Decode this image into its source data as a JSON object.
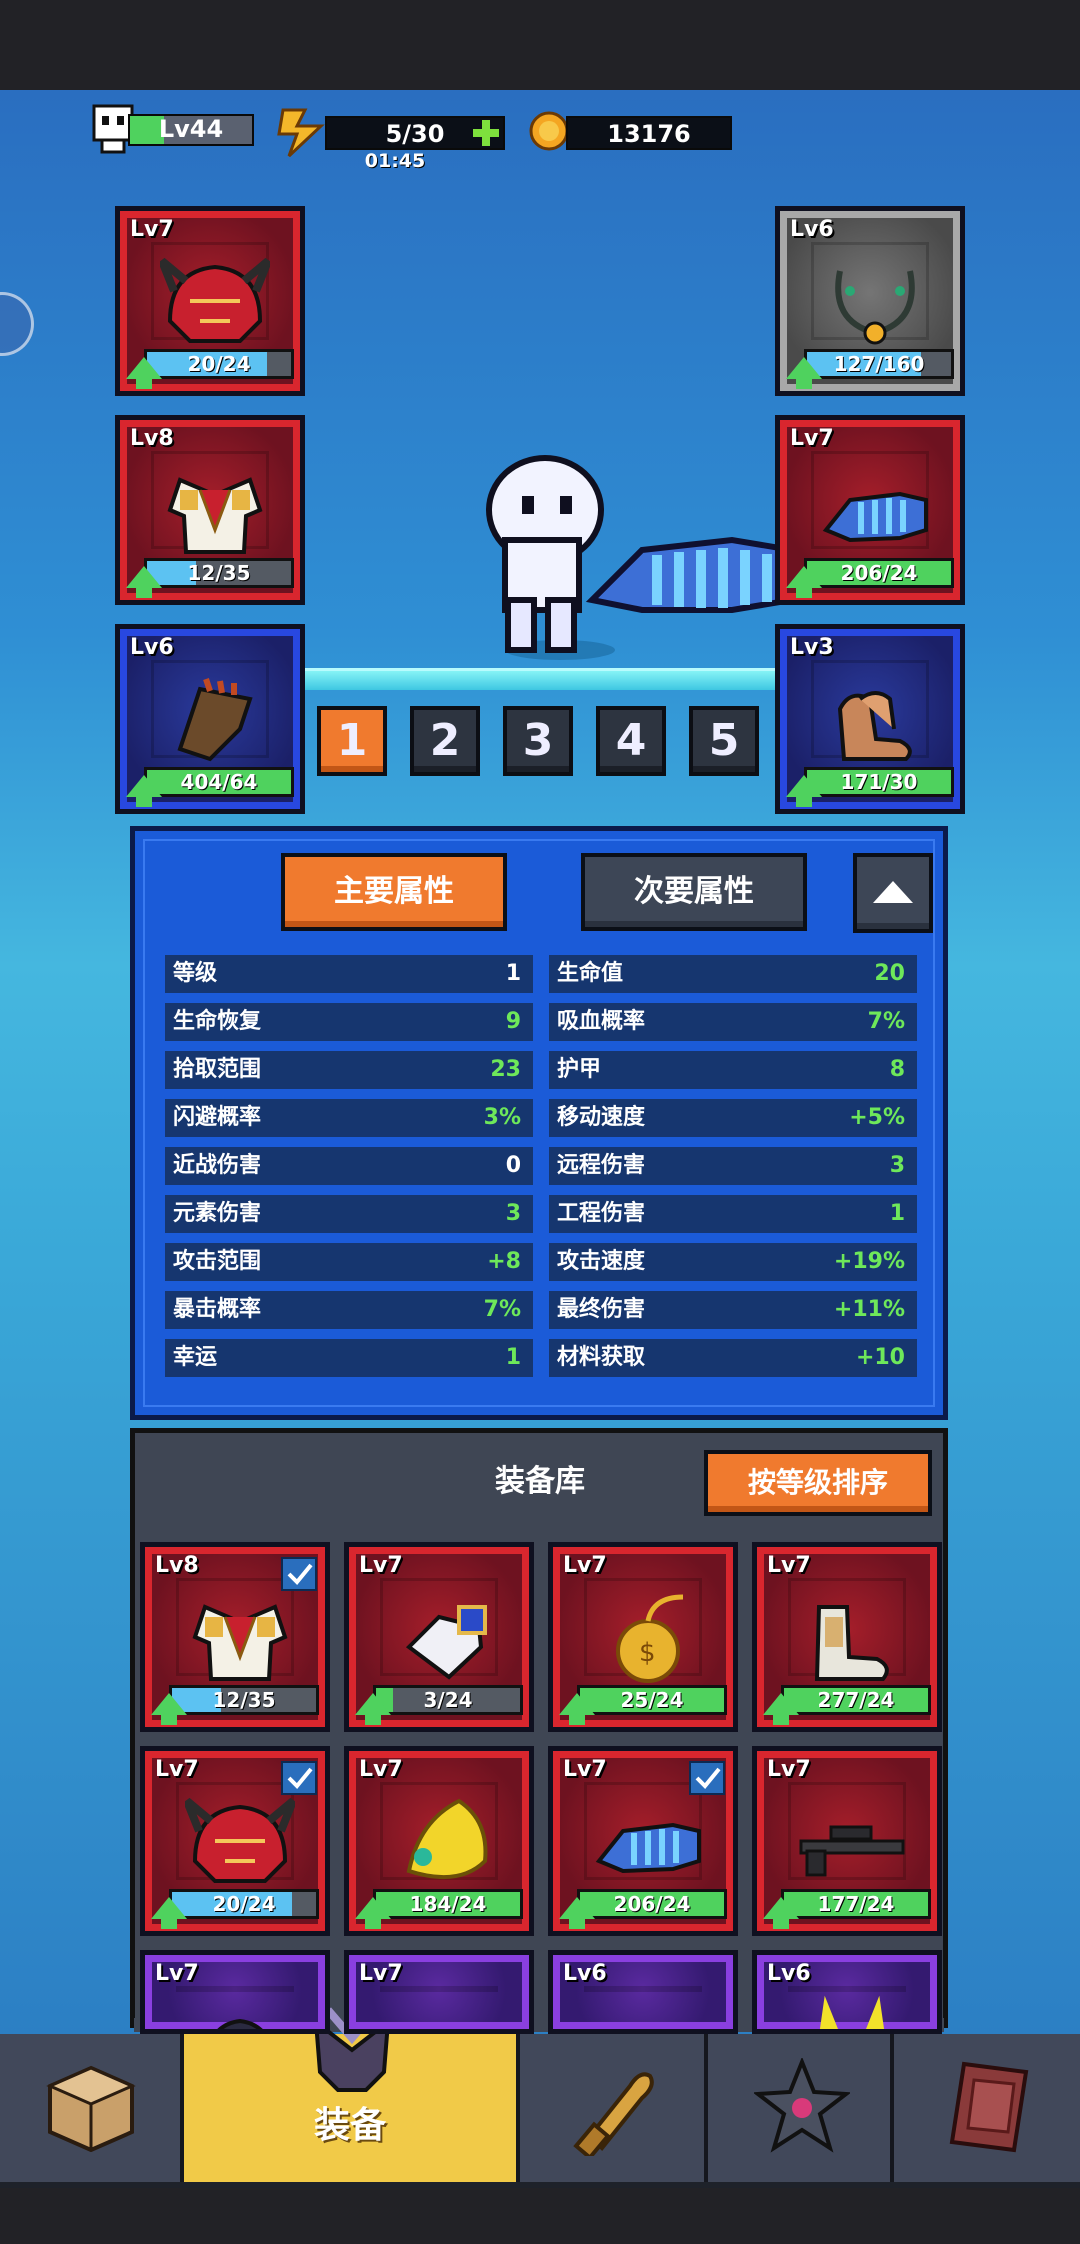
{
  "hud": {
    "player_level": "Lv44",
    "energy": "5/30",
    "energy_timer": "01:45",
    "coins": "13176"
  },
  "equipped": {
    "left": [
      {
        "level": "Lv7",
        "progress": "20/24",
        "rarity": "red",
        "bar": "blue",
        "fill": 0.83,
        "icon": "red-helmet-icon"
      },
      {
        "level": "Lv8",
        "progress": "12/35",
        "rarity": "red",
        "bar": "blue",
        "fill": 0.34,
        "icon": "armor-icon"
      },
      {
        "level": "Lv6",
        "progress": "404/64",
        "rarity": "blue",
        "bar": "green",
        "fill": 1.0,
        "icon": "gauntlet-icon"
      }
    ],
    "right": [
      {
        "level": "Lv6",
        "progress": "127/160",
        "rarity": "grey",
        "bar": "blue",
        "fill": 0.79,
        "icon": "necklace-icon"
      },
      {
        "level": "Lv7",
        "progress": "206/24",
        "rarity": "red",
        "bar": "green",
        "fill": 1.0,
        "icon": "blue-cannon-icon"
      },
      {
        "level": "Lv3",
        "progress": "171/30",
        "rarity": "blue",
        "bar": "green",
        "fill": 1.0,
        "icon": "boots-icon"
      }
    ]
  },
  "loadout_pages": [
    "1",
    "2",
    "3",
    "4",
    "5"
  ],
  "active_page": 0,
  "stats": {
    "tab_primary": "主要属性",
    "tab_secondary": "次要属性",
    "left": [
      {
        "k": "等级",
        "v": "1",
        "color": "#ffffff"
      },
      {
        "k": "生命恢复",
        "v": "9",
        "color": "#6ee85a"
      },
      {
        "k": "拾取范围",
        "v": "23",
        "color": "#6ee85a"
      },
      {
        "k": "闪避概率",
        "v": "3%",
        "color": "#6ee85a"
      },
      {
        "k": "近战伤害",
        "v": "0",
        "color": "#ffffff"
      },
      {
        "k": "元素伤害",
        "v": "3",
        "color": "#6ee85a"
      },
      {
        "k": "攻击范围",
        "v": "+8",
        "color": "#6ee85a"
      },
      {
        "k": "暴击概率",
        "v": "7%",
        "color": "#6ee85a"
      },
      {
        "k": "幸运",
        "v": "1",
        "color": "#6ee85a"
      }
    ],
    "right": [
      {
        "k": "生命值",
        "v": "20",
        "color": "#6ee85a"
      },
      {
        "k": "吸血概率",
        "v": "7%",
        "color": "#6ee85a"
      },
      {
        "k": "护甲",
        "v": "8",
        "color": "#6ee85a"
      },
      {
        "k": "移动速度",
        "v": "+5%",
        "color": "#6ee85a"
      },
      {
        "k": "远程伤害",
        "v": "3",
        "color": "#6ee85a"
      },
      {
        "k": "工程伤害",
        "v": "1",
        "color": "#6ee85a"
      },
      {
        "k": "攻击速度",
        "v": "+19%",
        "color": "#6ee85a"
      },
      {
        "k": "最终伤害",
        "v": "+11%",
        "color": "#6ee85a"
      },
      {
        "k": "材料获取",
        "v": "+10",
        "color": "#6ee85a"
      }
    ]
  },
  "inventory": {
    "title": "装备库",
    "sort_button": "按等级排序",
    "items": [
      {
        "level": "Lv8",
        "progress": "12/35",
        "rarity": "red",
        "bar": "blue",
        "fill": 0.34,
        "checked": true,
        "icon": "armor-icon"
      },
      {
        "level": "Lv7",
        "progress": "3/24",
        "rarity": "red",
        "bar": "green",
        "fill": 0.12,
        "checked": false,
        "icon": "glove-icon"
      },
      {
        "level": "Lv7",
        "progress": "25/24",
        "rarity": "red",
        "bar": "green",
        "fill": 1.0,
        "checked": false,
        "icon": "gold-pocket-watch-icon"
      },
      {
        "level": "Lv7",
        "progress": "277/24",
        "rarity": "red",
        "bar": "green",
        "fill": 1.0,
        "checked": false,
        "icon": "armored-boots-icon"
      },
      {
        "level": "Lv7",
        "progress": "20/24",
        "rarity": "red",
        "bar": "blue",
        "fill": 0.83,
        "checked": true,
        "icon": "red-helmet-icon"
      },
      {
        "level": "Lv7",
        "progress": "184/24",
        "rarity": "red",
        "bar": "green",
        "fill": 1.0,
        "checked": false,
        "icon": "golden-claw-icon"
      },
      {
        "level": "Lv7",
        "progress": "206/24",
        "rarity": "red",
        "bar": "green",
        "fill": 1.0,
        "checked": true,
        "icon": "blue-cannon-icon"
      },
      {
        "level": "Lv7",
        "progress": "177/24",
        "rarity": "red",
        "bar": "green",
        "fill": 1.0,
        "checked": false,
        "icon": "sniper-rifle-icon"
      },
      {
        "level": "Lv7",
        "progress": "",
        "rarity": "purple",
        "bar": "none",
        "fill": 0,
        "checked": false,
        "icon": "dark-helmet-icon"
      },
      {
        "level": "Lv7",
        "progress": "",
        "rarity": "purple",
        "bar": "none",
        "fill": 0,
        "checked": false,
        "icon": "item-icon"
      },
      {
        "level": "Lv6",
        "progress": "",
        "rarity": "purple",
        "bar": "none",
        "fill": 0,
        "checked": false,
        "icon": "chain-icon"
      },
      {
        "level": "Lv6",
        "progress": "",
        "rarity": "purple",
        "bar": "none",
        "fill": 0,
        "checked": false,
        "icon": "golden-horns-icon"
      }
    ]
  },
  "nav": {
    "equipment_label": "装备",
    "items": [
      "box-icon",
      "equipment-armor-icon",
      "bullet-icon",
      "dark-star-icon",
      "spellbook-icon"
    ]
  }
}
